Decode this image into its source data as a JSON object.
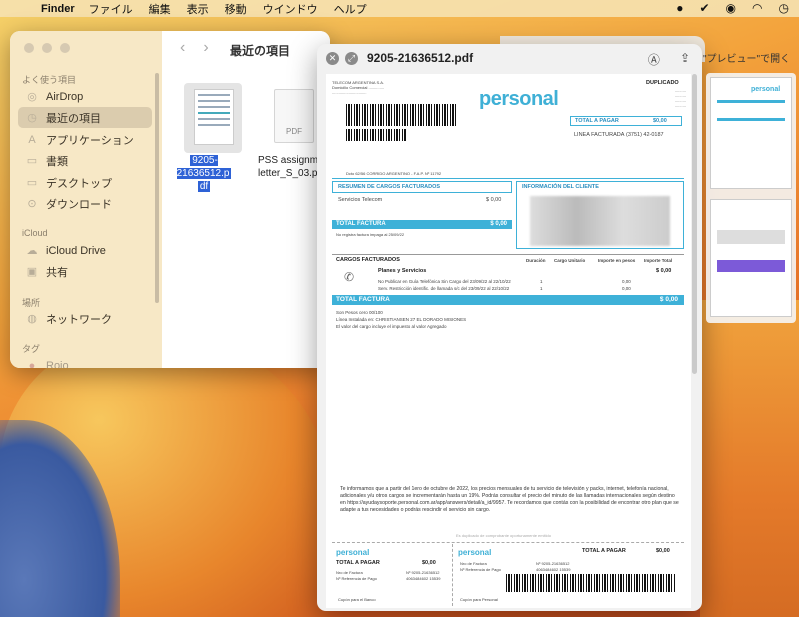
{
  "menubar": {
    "app": "Finder",
    "items": [
      "ファイル",
      "編集",
      "表示",
      "移動",
      "ウインドウ",
      "ヘルプ"
    ]
  },
  "finder": {
    "title": "最近の項目",
    "sidebar": {
      "favorites_header": "よく使う項目",
      "items": [
        {
          "label": "AirDrop",
          "icon": "airdrop-icon"
        },
        {
          "label": "最近の項目",
          "icon": "clock-icon"
        },
        {
          "label": "アプリケーション",
          "icon": "applications-icon"
        },
        {
          "label": "書類",
          "icon": "document-icon"
        },
        {
          "label": "デスクトップ",
          "icon": "desktop-icon"
        },
        {
          "label": "ダウンロード",
          "icon": "download-icon"
        }
      ],
      "icloud_header": "iCloud",
      "icloud_items": [
        {
          "label": "iCloud Drive",
          "icon": "cloud-icon"
        },
        {
          "label": "共有",
          "icon": "shared-folder-icon"
        }
      ],
      "locations_header": "場所",
      "locations_items": [
        {
          "label": "ネットワーク",
          "icon": "network-icon"
        }
      ],
      "tags_header": "タグ",
      "tags_items": [
        {
          "label": "Rojo"
        }
      ]
    },
    "files": [
      {
        "name_line1": "9205-21636512.p",
        "name_line2": "df"
      },
      {
        "name_line1": "PSS assignme",
        "name_line2": "letter_S_03.p",
        "thumb_label": "PDF"
      }
    ]
  },
  "quicklook": {
    "title": "9205-21636512.pdf",
    "open_button": "\"プレビュー\"で開く",
    "bill": {
      "brand": "personal",
      "duplicado": "DUPLICADO",
      "total_a_pagar": "TOTAL A PAGAR",
      "total_amount": "$0,00",
      "linea_facturada": "LINEA FACTURADA",
      "linea_num": "(3751) 42-0187",
      "address": "Dcto 62/56 CORRIDO ARGENTINO - F.A.P. Nº 11792",
      "resumen_header": "RESUMEN DE CARGOS FACTURADOS",
      "info_header": "INFORMACIÓN DEL CLIENTE",
      "servicios_label": "Servicios Telecom",
      "servicios_amount": "$ 0,00",
      "total_factura": "TOTAL FACTURA",
      "total_factura_amount": "$ 0,00",
      "no_registra": "No registra factura impaga al 25/09/22",
      "cargos_header": "CARGOS FACTURADOS",
      "col_duracion": "Duración",
      "col_cargo": "Cargo Unitario",
      "col_importe": "Importe en pesos",
      "col_total": "Importe Total",
      "planes": "Planes y Servicios",
      "planes_amount": "$ 0,00",
      "row1": "No Publicar en Guía Telefónica Sin Cargo del 23/09/22 al 22/10/22",
      "row1_dur": "1",
      "row1_imp": "0,00",
      "row2": "Serv. Restricción identific. de llamada s/c del 23/09/22 al 22/10/22",
      "row2_dur": "1",
      "row2_imp": "0,00",
      "note1": "Son Pesos cero 00/100",
      "note2": "Línea Instalada en: CHRISTIANSEN 27 EL DORADO MISIONES",
      "note3": "El valor del cargo incluye el impuesto al valor Agregado",
      "paragraph": "Te informamos que a partir del 1ero de octubre de 2022, los precios mensuales de tu servicio de televisión y packs, internet, telefonía nacional, adicionales y/u otros cargos se incrementarán hasta un 19%. Podrás consultar el precio del minuto de las llamadas internacionales según destino en https://ayudaysoporte.personal.com.ar/app/answers/detail/a_id/9957. Te recordamos que contás con la posibilidad de encontrar otro plan que se adapte a tus necesidades o podrás rescindir el servicio sin cargo.",
      "duplicado_note": "Es duplicado de comprobante oportunamente emitido",
      "stub_nro": "Nro de Factura",
      "stub_ref": "Nº Referencia de Pago",
      "stub_nro_val": "Nº 9205-21636512",
      "stub_ref_val": "4063484602 15539",
      "cupon_banco": "Cupón para el Banco",
      "cupon_personal": "Cupón para Personal"
    }
  }
}
